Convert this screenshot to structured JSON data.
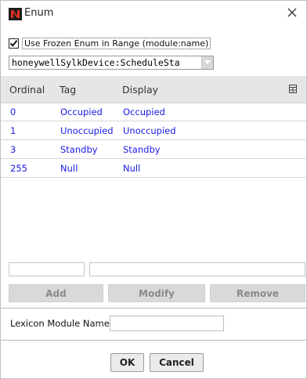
{
  "window": {
    "title": "Enum",
    "app_icon": "niagara-n-icon",
    "close_icon": "close-icon"
  },
  "frozen_enum": {
    "checked": true,
    "label": "Use Frozen Enum in Range (module:name)"
  },
  "enum_select": {
    "value": "honeywellSylkDevice:ScheduleSta"
  },
  "table": {
    "columns": [
      "Ordinal",
      "Tag",
      "Display"
    ],
    "rows": [
      {
        "ordinal": "0",
        "tag": "Occupied",
        "display": "Occupied"
      },
      {
        "ordinal": "1",
        "tag": "Unoccupied",
        "display": "Unoccupied"
      },
      {
        "ordinal": "3",
        "tag": "Standby",
        "display": "Standby"
      },
      {
        "ordinal": "255",
        "tag": "Null",
        "display": "Null"
      }
    ]
  },
  "edit": {
    "ordinal_value": "",
    "tag_value": "",
    "add_label": "Add",
    "modify_label": "Modify",
    "remove_label": "Remove"
  },
  "lexicon": {
    "label": "Lexicon Module Name",
    "value": ""
  },
  "footer": {
    "ok_label": "OK",
    "cancel_label": "Cancel"
  },
  "colors": {
    "value_text": "#1a1ae6",
    "header_bg": "#e6e6e6",
    "disabled_button_bg": "#d9d9d9",
    "app_icon_bg": "#1c1c1c",
    "app_icon_fg": "#e0301e"
  }
}
